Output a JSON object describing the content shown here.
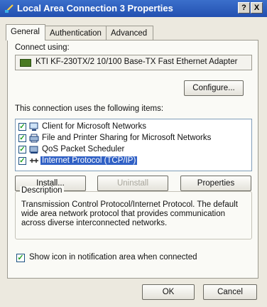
{
  "window": {
    "title": "Local Area Connection 3 Properties",
    "help_button": "?",
    "close_button": "X"
  },
  "tabs": [
    {
      "label": "General",
      "active": true
    },
    {
      "label": "Authentication",
      "active": false
    },
    {
      "label": "Advanced",
      "active": false
    }
  ],
  "connect_using": {
    "label": "Connect using:",
    "adapter": "KTI KF-230TX/2 10/100 Base-TX Fast Ethernet Adapter",
    "configure_button": "Configure..."
  },
  "items_section": {
    "label": "This connection uses the following items:",
    "items": [
      {
        "label": "Client for Microsoft Networks",
        "checked": true,
        "icon": "network-client-icon",
        "selected": false
      },
      {
        "label": "File and Printer Sharing for Microsoft Networks",
        "checked": true,
        "icon": "printer-sharing-icon",
        "selected": false
      },
      {
        "label": "QoS Packet Scheduler",
        "checked": true,
        "icon": "scheduler-icon",
        "selected": false
      },
      {
        "label": "Internet Protocol (TCP/IP)",
        "checked": true,
        "icon": "protocol-icon",
        "selected": true
      }
    ]
  },
  "buttons": {
    "install": "Install...",
    "uninstall": "Uninstall",
    "properties": "Properties"
  },
  "description": {
    "legend": "Description",
    "text": "Transmission Control Protocol/Internet Protocol. The default wide area network protocol that provides communication across diverse interconnected networks."
  },
  "show_icon": {
    "label": "Show icon in notification area when connected",
    "checked": true
  },
  "dialog_buttons": {
    "ok": "OK",
    "cancel": "Cancel"
  }
}
